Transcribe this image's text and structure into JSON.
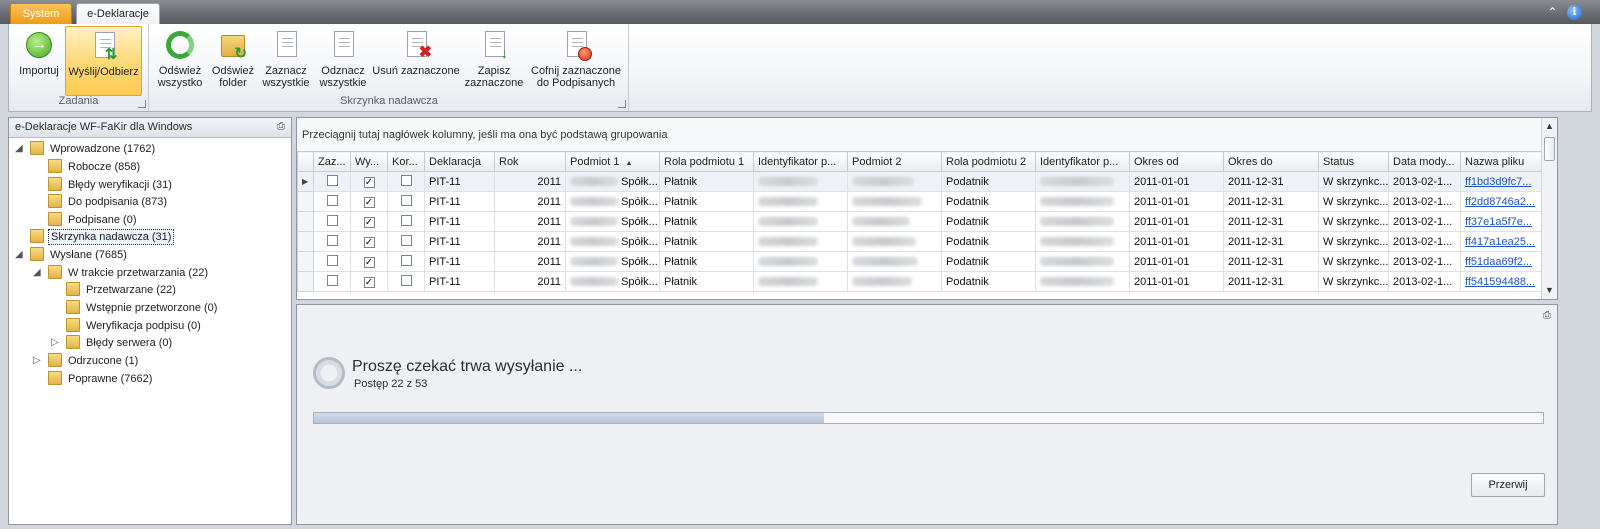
{
  "tabs": {
    "system": "System",
    "active": "e-Deklaracje"
  },
  "ribbon": {
    "groups": {
      "tasks": "Zadania",
      "outbox": "Skrzynka nadawcza"
    },
    "buttons": {
      "import": "Importuj",
      "send_receive": "Wyślij/Odbierz",
      "refresh_all_1": "Odśwież",
      "refresh_all_2": "wszystko",
      "refresh_folder_1": "Odśwież",
      "refresh_folder_2": "folder",
      "select_all_1": "Zaznacz",
      "select_all_2": "wszystkie",
      "deselect_all_1": "Odznacz",
      "deselect_all_2": "wszystkie",
      "delete_selected": "Usuń zaznaczone",
      "save_selected_1": "Zapisz",
      "save_selected_2": "zaznaczone",
      "revert_selected_1": "Cofnij zaznaczone",
      "revert_selected_2": "do Podpisanych"
    }
  },
  "left_panel": {
    "title": "e-Deklaracje WF-FaKir dla Windows",
    "tree": {
      "entered": "Wprowadzone (1762)",
      "drafts": "Robocze (858)",
      "verification_errors": "Błędy weryfikacji (31)",
      "to_sign": "Do podpisania (873)",
      "signed": "Podpisane (0)",
      "outbox": "Skrzynka nadawcza (31)",
      "sent": "Wysłane (7685)",
      "in_processing": "W trakcie przetwarzania (22)",
      "processed": "Przetwarzane (22)",
      "preprocessed": "Wstępnie przetworzone (0)",
      "signature_verification": "Weryfikacja podpisu (0)",
      "server_errors": "Błędy serwera (0)",
      "rejected": "Odrzucone (1)",
      "correct": "Poprawne (7662)"
    }
  },
  "grid": {
    "group_hint": "Przeciągnij tutaj nagłówek kolumny, jeśli ma ona być podstawą grupowania",
    "columns": [
      "Zaz...",
      "Wy...",
      "Kor...",
      "Deklaracja",
      "Rok",
      "Podmiot 1",
      "Rola podmiotu 1",
      "Identyfikator p...",
      "Podmiot 2",
      "Rola podmiotu 2",
      "Identyfikator p...",
      "Okres od",
      "Okres do",
      "Status",
      "Data mody...",
      "Nazwa pliku"
    ],
    "rows": [
      {
        "declaration": "PIT-11",
        "year": "2011",
        "subject1": "Spółk...",
        "role1": "Płatnik",
        "role2": "Podatnik",
        "from": "2011-01-01",
        "to": "2011-12-31",
        "status": "W skrzynkc...",
        "modified": "2013-02-1...",
        "file": "ff1bd3d9fc7..."
      },
      {
        "declaration": "PIT-11",
        "year": "2011",
        "subject1": "Spółk...",
        "role1": "Płatnik",
        "role2": "Podatnik",
        "from": "2011-01-01",
        "to": "2011-12-31",
        "status": "W skrzynkc...",
        "modified": "2013-02-1...",
        "file": "ff2dd8746a2..."
      },
      {
        "declaration": "PIT-11",
        "year": "2011",
        "subject1": "Spółk...",
        "role1": "Płatnik",
        "role2": "Podatnik",
        "from": "2011-01-01",
        "to": "2011-12-31",
        "status": "W skrzynkc...",
        "modified": "2013-02-1...",
        "file": "ff37e1a5f7e..."
      },
      {
        "declaration": "PIT-11",
        "year": "2011",
        "subject1": "Spółk...",
        "role1": "Płatnik",
        "role2": "Podatnik",
        "from": "2011-01-01",
        "to": "2011-12-31",
        "status": "W skrzynkc...",
        "modified": "2013-02-1...",
        "file": "ff417a1ea25..."
      },
      {
        "declaration": "PIT-11",
        "year": "2011",
        "subject1": "Spółk...",
        "role1": "Płatnik",
        "role2": "Podatnik",
        "from": "2011-01-01",
        "to": "2011-12-31",
        "status": "W skrzynkc...",
        "modified": "2013-02-1...",
        "file": "ff51daa69f2..."
      },
      {
        "declaration": "PIT-11",
        "year": "2011",
        "subject1": "Spółk...",
        "role1": "Płatnik",
        "role2": "Podatnik",
        "from": "2011-01-01",
        "to": "2011-12-31",
        "status": "W skrzynkc...",
        "modified": "2013-02-1...",
        "file": "ff541594488..."
      }
    ]
  },
  "progress": {
    "title": "Proszę czekać trwa wysyłanie ...",
    "status": "Postęp 22 z 53",
    "fraction": 0.415,
    "abort": "Przerwij"
  }
}
